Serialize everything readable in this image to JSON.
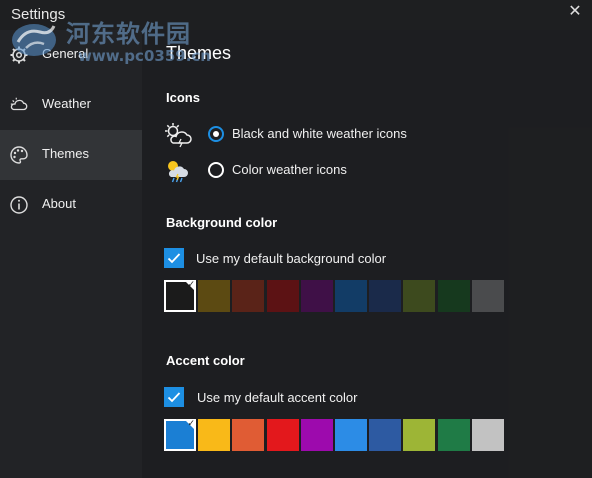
{
  "window": {
    "title": "Settings",
    "close_glyph": "✕"
  },
  "watermark": {
    "title": "河东软件园",
    "url": "www.pc0359.cn"
  },
  "sidebar": {
    "items": [
      {
        "label": "General",
        "icon": "gear-icon",
        "selected": false
      },
      {
        "label": "Weather",
        "icon": "weather-cloud-icon",
        "selected": false
      },
      {
        "label": "Themes",
        "icon": "palette-icon",
        "selected": true
      },
      {
        "label": "About",
        "icon": "info-icon",
        "selected": false
      }
    ]
  },
  "main": {
    "heading": "Themes",
    "icons_section": {
      "title": "Icons",
      "options": [
        {
          "label": "Black and white weather icons",
          "checked": true,
          "icon": "monochrome-weather-icon"
        },
        {
          "label": "Color weather icons",
          "checked": false,
          "icon": "color-weather-icon"
        }
      ]
    },
    "background_section": {
      "title": "Background color",
      "checkbox_label": "Use my default background color",
      "checked": true,
      "swatches": [
        "#1b1b1b",
        "#5c4a12",
        "#5a2318",
        "#5c1214",
        "#3f1047",
        "#123c66",
        "#1a2a4a",
        "#3d4a1e",
        "#16391e",
        "#4a4b4d"
      ],
      "selected_index": 0
    },
    "accent_section": {
      "title": "Accent color",
      "checkbox_label": "Use my default accent color",
      "checked": true,
      "swatches": [
        "#1b7fd4",
        "#f9b918",
        "#e05c34",
        "#e3181c",
        "#9d0aad",
        "#2c8ce6",
        "#2d5aa2",
        "#9db536",
        "#1f7b46",
        "#c2c2c2"
      ],
      "selected_index": 0
    }
  },
  "colors": {
    "accent": "#1d8fe3",
    "sidebar": "#222326",
    "content": "#1d1e20"
  }
}
